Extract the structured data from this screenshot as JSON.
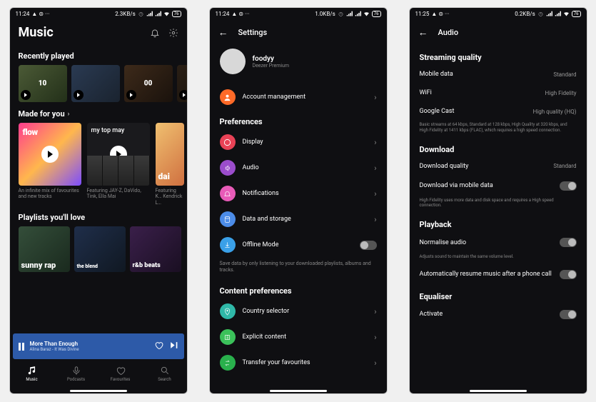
{
  "status": {
    "time1": "11:24",
    "time2": "11:24",
    "time3": "11:25",
    "icons_left": "▲  ⊜  ···",
    "rate1": "2.3KB/s",
    "rate2": "1.0KB/s",
    "rate3": "0.2KB/s",
    "batt": "76"
  },
  "p1": {
    "title": "Music",
    "recent_title": "Recently played",
    "recent": [
      {
        "label": "10"
      },
      {
        "label": ""
      },
      {
        "label": "00"
      },
      {
        "label": ""
      }
    ],
    "made_title": "Made for you",
    "made": [
      {
        "type": "flow",
        "label": "flow",
        "meta": "An infinite mix of favourites and new tracks"
      },
      {
        "type": "top",
        "label": "my top may",
        "meta": "Featuring JAY-Z, DaVido, Tink, Ella Mai"
      },
      {
        "type": "dai",
        "label": "dai",
        "meta": "Featuring K… Kendrick L…"
      }
    ],
    "pl_title": "Playlists you'll love",
    "pl": [
      {
        "t": "sunny rap"
      },
      {
        "t": "the blend"
      },
      {
        "t": "r&b beats"
      }
    ],
    "player": {
      "track": "More Than Enough",
      "artist": "Alina Baraz - It Was Divine"
    },
    "nav": [
      {
        "i": "music",
        "l": "Music"
      },
      {
        "i": "podcasts",
        "l": "Podcasts"
      },
      {
        "i": "favourites",
        "l": "Favourites"
      },
      {
        "i": "search",
        "l": "Search"
      }
    ]
  },
  "p2": {
    "title": "Settings",
    "user": {
      "name": "foodyy",
      "plan": "Deezer Premium"
    },
    "account": "Account management",
    "pref_head": "Preferences",
    "prefs": [
      {
        "c": "bg-red",
        "l": "Display"
      },
      {
        "c": "bg-purple",
        "l": "Audio"
      },
      {
        "c": "bg-pink",
        "l": "Notifications"
      },
      {
        "c": "bg-blue",
        "l": "Data and storage"
      },
      {
        "c": "bg-sky",
        "l": "Offline Mode",
        "toggle": true
      }
    ],
    "offline_hint": "Save data by only listening to your downloaded playlists, albums and tracks.",
    "content_head": "Content preferences",
    "content": [
      {
        "c": "bg-teal",
        "l": "Country selector"
      },
      {
        "c": "bg-green",
        "l": "Explicit content"
      },
      {
        "c": "bg-g2",
        "l": "Transfer your favourites"
      }
    ]
  },
  "p3": {
    "title": "Audio",
    "stream_head": "Streaming quality",
    "stream": [
      {
        "l": "Mobile data",
        "v": "Standard"
      },
      {
        "l": "WiFi",
        "v": "High Fidelity"
      },
      {
        "l": "Google Cast",
        "v": "High quality (HQ)"
      }
    ],
    "stream_hint": "Basic streams at 64 kbps, Standard at 128 kbps, High Quality at 320 kbps, and High Fidelity at 1411 kbps (FLAC), which requires a high speed connection.",
    "dl_head": "Download",
    "dl_quality": {
      "l": "Download quality",
      "v": "Standard"
    },
    "dl_mobile": {
      "l": "Download via mobile data"
    },
    "dl_hint": "High Fidelity uses more data and disk space and requires a High speed connection.",
    "pb_head": "Playback",
    "normalise": {
      "l": "Normalise audio"
    },
    "normalise_hint": "Adjusts sound to maintain the same volume level.",
    "resume": {
      "l": "Automatically resume music after a phone call"
    },
    "eq_head": "Equaliser",
    "activate": {
      "l": "Activate"
    }
  }
}
